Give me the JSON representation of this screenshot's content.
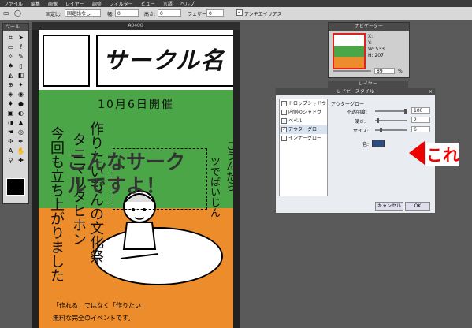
{
  "menu": [
    "ファイル",
    "編集",
    "画像",
    "レイヤー",
    "調整",
    "フィルター",
    "ビュー",
    "言語",
    "ヘルプ"
  ],
  "options": {
    "fixed_ratio_label": "固定比:",
    "fixed_ratio_value": "固定比なし",
    "width_label": "幅:",
    "width_value": "0",
    "height_label": "高さ:",
    "height_value": "0",
    "feather_label": "フェザー:",
    "feather_value": "0",
    "antialias_label": "アンチエイリアス",
    "antialias_checked": true
  },
  "toolbox": {
    "title": "ツール",
    "fg_color": "#000000"
  },
  "document": {
    "title": "A0400",
    "poster_title": "サークル名",
    "date": "10月6日開催",
    "vertical_1": "作りたいもんの文化祭",
    "vertical_2": "タニマリタヒホン",
    "vertical_3": "今回も立ち上がりました",
    "vertical_4": "こうんだら",
    "vertical_5": "ツでばいじん",
    "overlay_1": "こんなサーク",
    "overlay_2": "ルですよ！",
    "tagline_1": "「作れる」ではなく「作りたい」",
    "tagline_2": "無料な完全のイベントです。"
  },
  "navigator": {
    "title": "ナビゲーター",
    "x_label": "X:",
    "y_label": "Y:",
    "w_label": "W:",
    "w_value": "533",
    "h_label": "H:",
    "h_value": "207",
    "zoom": "89",
    "zoom_unit": "%"
  },
  "layers_title": "レイヤー",
  "dialog": {
    "title": "レイヤースタイル",
    "close": "×",
    "styles": [
      {
        "label": "ドロップシャドウ",
        "checked": false
      },
      {
        "label": "内側のシャドウ",
        "checked": false
      },
      {
        "label": "ベベル",
        "checked": false
      },
      {
        "label": "アウターグロー",
        "checked": true
      },
      {
        "label": "インナーグロー",
        "checked": false
      }
    ],
    "section_title": "アウターグロー",
    "opacity_label": "不透明度:",
    "opacity_value": "100",
    "hardness_label": "硬さ:",
    "hardness_value": "2",
    "size_label": "サイズ:",
    "size_value": "6",
    "color_label": "色:",
    "glow_color": "#2d4b7c",
    "cancel": "キャンセル",
    "ok": "OK"
  },
  "annotation": {
    "text": "これ",
    "color": "#e00000"
  },
  "colors": {
    "green": "#4ba647",
    "orange": "#ec8c2a",
    "bg": "#5a5a5a"
  }
}
